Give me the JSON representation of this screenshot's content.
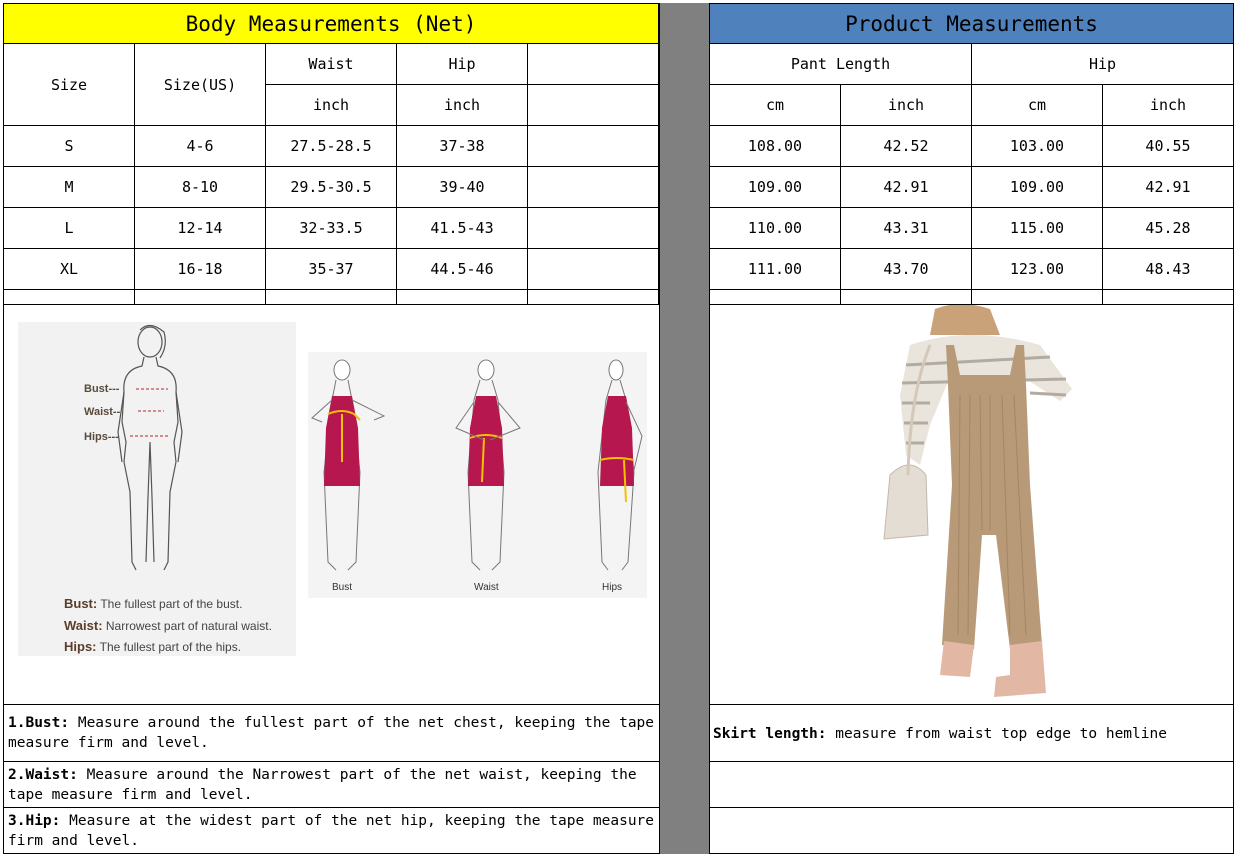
{
  "body_table": {
    "title": "Body Measurements (Net)",
    "col_size": "Size",
    "col_size_us": "Size(US)",
    "col_waist": "Waist",
    "col_hip": "Hip",
    "unit_waist": "inch",
    "unit_hip": "inch",
    "rows": [
      {
        "size": "S",
        "us": "4-6",
        "waist": "27.5-28.5",
        "hip": "37-38"
      },
      {
        "size": "M",
        "us": "8-10",
        "waist": "29.5-30.5",
        "hip": "39-40"
      },
      {
        "size": "L",
        "us": "12-14",
        "waist": "32-33.5",
        "hip": "41.5-43"
      },
      {
        "size": "XL",
        "us": "16-18",
        "waist": "35-37",
        "hip": "44.5-46"
      }
    ]
  },
  "product_table": {
    "title": "Product Measurements",
    "col_pant_length": "Pant Length",
    "col_hip": "Hip",
    "units": [
      "cm",
      "inch",
      "cm",
      "inch"
    ],
    "rows": [
      {
        "pl_cm": "108.00",
        "pl_in": "42.52",
        "hip_cm": "103.00",
        "hip_in": "40.55"
      },
      {
        "pl_cm": "109.00",
        "pl_in": "42.91",
        "hip_cm": "109.00",
        "hip_in": "42.91"
      },
      {
        "pl_cm": "110.00",
        "pl_in": "43.31",
        "hip_cm": "115.00",
        "hip_in": "45.28"
      },
      {
        "pl_cm": "111.00",
        "pl_in": "43.70",
        "hip_cm": "123.00",
        "hip_in": "48.43"
      }
    ]
  },
  "guide": {
    "label_bust": "Bust---",
    "label_waist": "Waist--",
    "label_hips": "Hips---",
    "def_bust_term": "Bust:",
    "def_bust_text": "The fullest part of the bust.",
    "def_waist_term": "Waist:",
    "def_waist_text": "Narrowest part of natural waist.",
    "def_hips_term": "Hips:",
    "def_hips_text": "The fullest part of the hips.",
    "fig_bust": "Bust",
    "fig_waist": "Waist",
    "fig_hips": "Hips"
  },
  "notes": {
    "bust_term": "1.Bust:",
    "bust_text": " Measure around the fullest part of the net chest, keeping the tape  measure firm and level.",
    "waist_term": "2.Waist:",
    "waist_text": " Measure around the Narrowest part of the net waist, keeping the tape  measure firm and level.",
    "hip_term": "3.Hip:",
    "hip_text": " Measure at the widest part of the net hip, keeping the tape measure firm and level.",
    "skirt_term": "Skirt length:",
    "skirt_text": " measure from waist top edge to hemline"
  },
  "colors": {
    "body_header": "#ffff00",
    "product_header": "#4f81bd",
    "divider": "#808080",
    "dress": "#b5174e",
    "tape": "#f2c200",
    "overalls": "#b89a78"
  }
}
